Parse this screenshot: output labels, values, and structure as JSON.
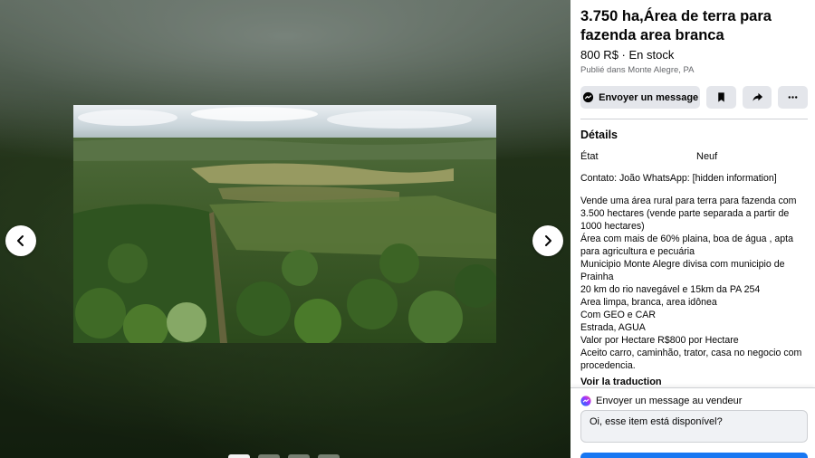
{
  "listing": {
    "title": "3.750 ha,Área de terra para fazenda area branca",
    "price": "800 R$ · En stock",
    "location": "Publié dans Monte Alegre, PA"
  },
  "actions": {
    "message_label": "Envoyer un message",
    "save_icon": "bookmark-icon",
    "share_icon": "share-icon",
    "more_icon": "more-icon"
  },
  "details": {
    "heading": "Détails",
    "state_label": "État",
    "state_value": "Neuf",
    "contact": "Contato: João WhatsApp: [hidden information]",
    "description": "Vende uma área rural para terra para fazenda com 3.500 hectares (vende parte separada a partir de 1000 hectares)\nÁrea com mais de 60% plaina, boa de água , apta para agricultura e pecuária\nMunicipio  Monte Alegre divisa com municipio de Prainha\n20 km do rio navegável e 15km da PA 254\nArea limpa, branca, area idônea\nCom  GEO e CAR\nEstrada, AGUA\nValor por Hectare R$800 por Hectare\nAceito carro, caminhão, trator, casa no negocio com procedencia.",
    "translate_label": "Voir la traduction"
  },
  "seller_message": {
    "heading": "Envoyer un message au vendeur",
    "value": "Oi, esse item está disponível?"
  },
  "viewer": {
    "prev_icon": "chevron-left-icon",
    "next_icon": "chevron-right-icon",
    "thumbnail_count": 4,
    "active_thumbnail": 1
  },
  "colors": {
    "accent": "#1877f2",
    "button_bg": "#e4e6eb",
    "text": "#050505",
    "secondary_text": "#65676b"
  }
}
